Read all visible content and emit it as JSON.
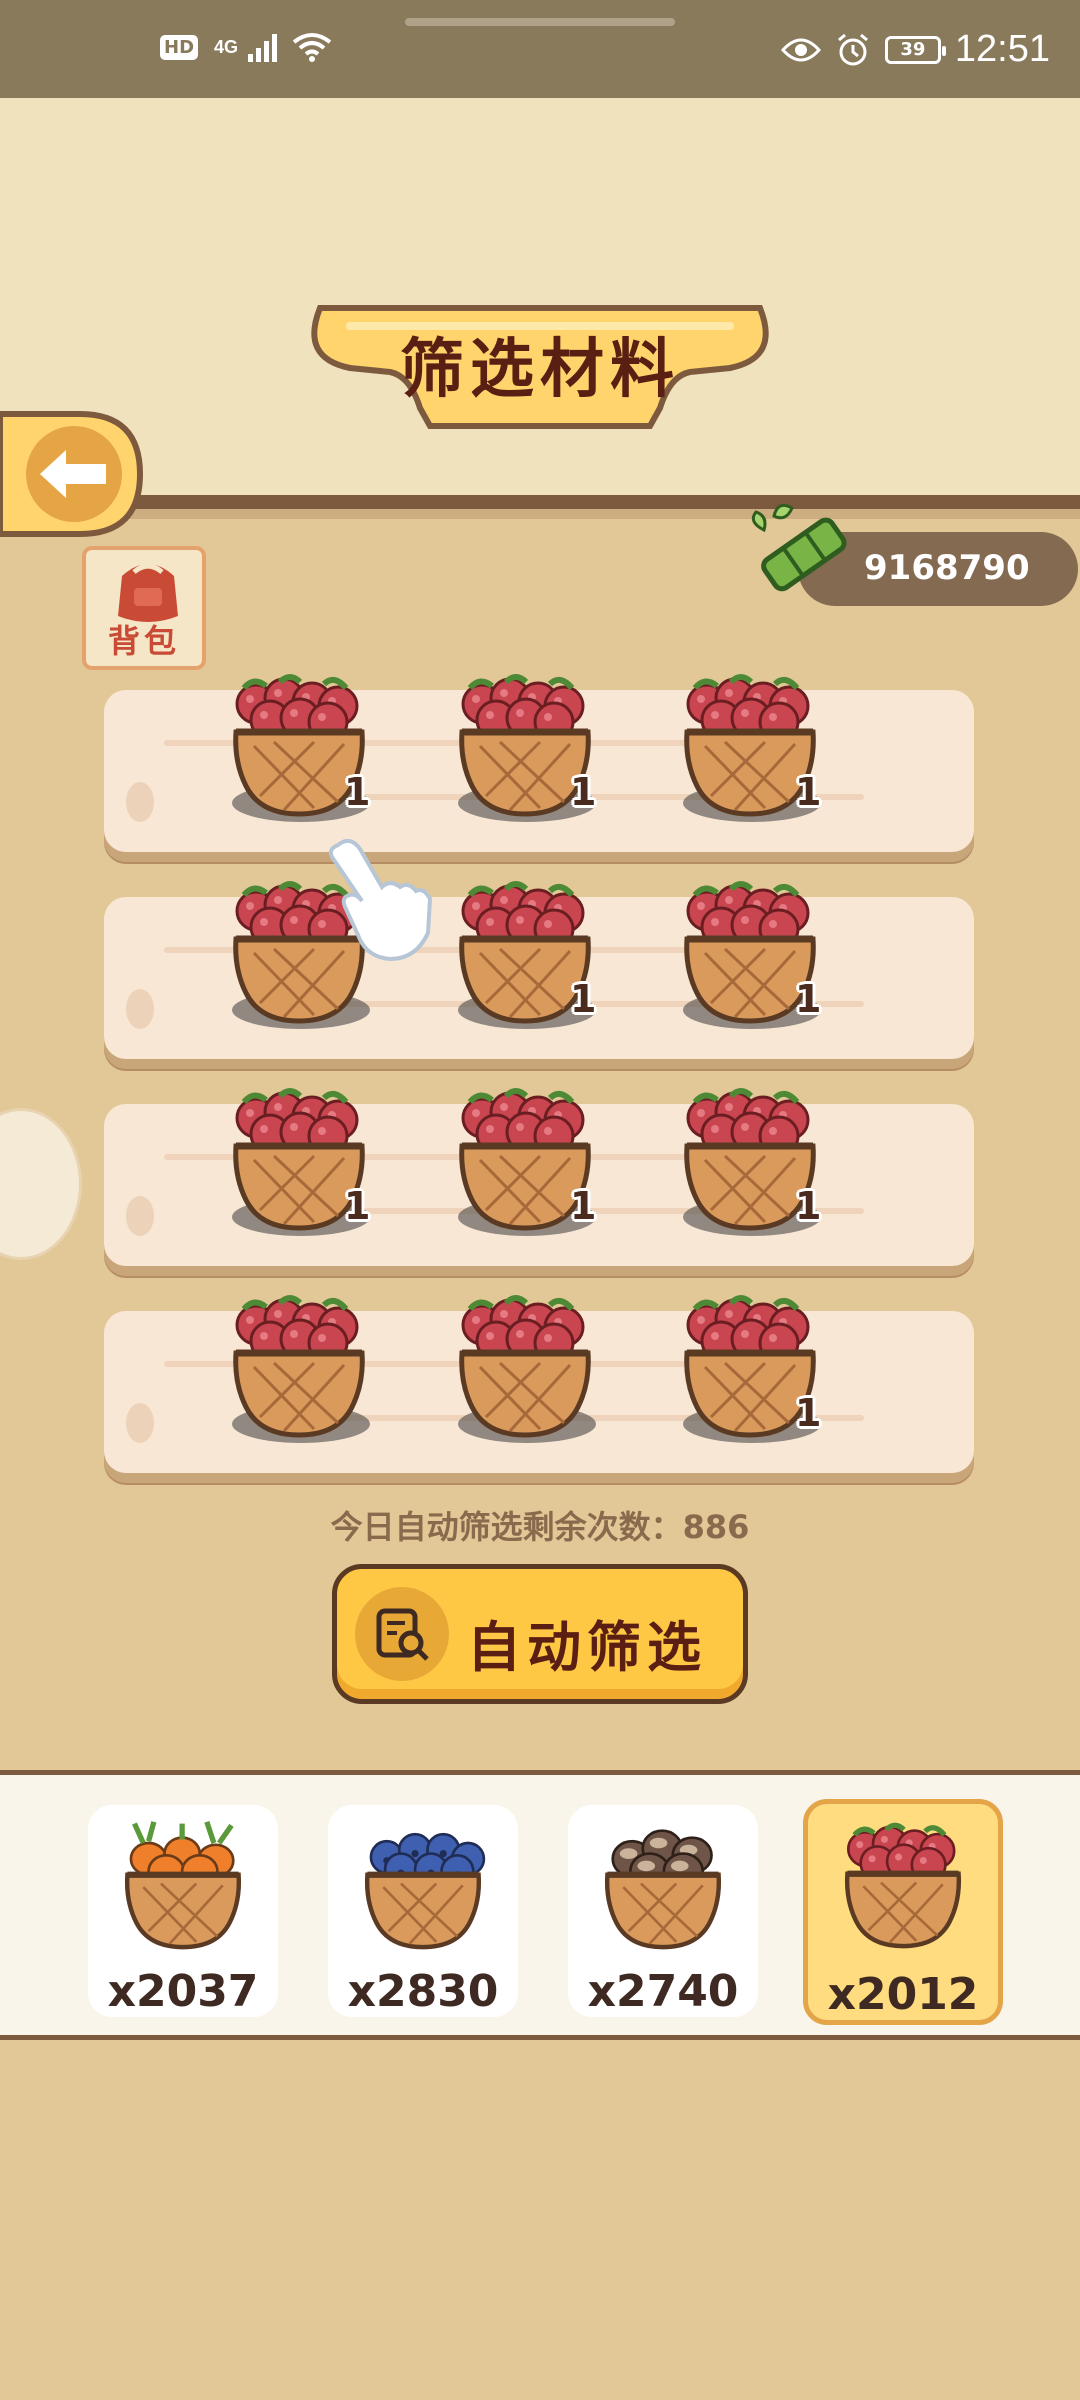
{
  "status_bar": {
    "hd": "HD",
    "network": "4G",
    "battery": "39",
    "time": "12:51",
    "icons": [
      "wifi-icon",
      "eye-icon",
      "alarm-icon",
      "battery-icon"
    ]
  },
  "header": {
    "title": "筛选材料",
    "back_icon": "arrow-left-icon"
  },
  "backpack": {
    "label": "背包",
    "icon": "backpack-icon"
  },
  "currency": {
    "icon": "bamboo-icon",
    "value": "9168790"
  },
  "grid": {
    "item": "raspberry-basket",
    "rows": [
      {
        "counts": [
          "1",
          "1",
          "1"
        ]
      },
      {
        "counts": [
          "",
          "1",
          "1"
        ]
      },
      {
        "counts": [
          "1",
          "1",
          "1"
        ]
      },
      {
        "counts": [
          "",
          "",
          "1"
        ]
      }
    ]
  },
  "remaining_label": "今日自动筛选剩余次数：886",
  "auto_button": {
    "label": "自动筛选",
    "icon": "search-document-icon"
  },
  "tray": {
    "items": [
      {
        "name": "carrot-basket",
        "count": "x2037",
        "selected": false
      },
      {
        "name": "blueberry-basket",
        "count": "x2830",
        "selected": false
      },
      {
        "name": "mushroom-basket",
        "count": "x2740",
        "selected": false
      },
      {
        "name": "raspberry-basket",
        "count": "x2012",
        "selected": true
      }
    ]
  },
  "colors": {
    "background": "#e2c797",
    "header_bg": "#efe2bd",
    "title_color": "#5a1f12",
    "button_yellow": "#ffc844",
    "currency_bg": "#856a52"
  }
}
